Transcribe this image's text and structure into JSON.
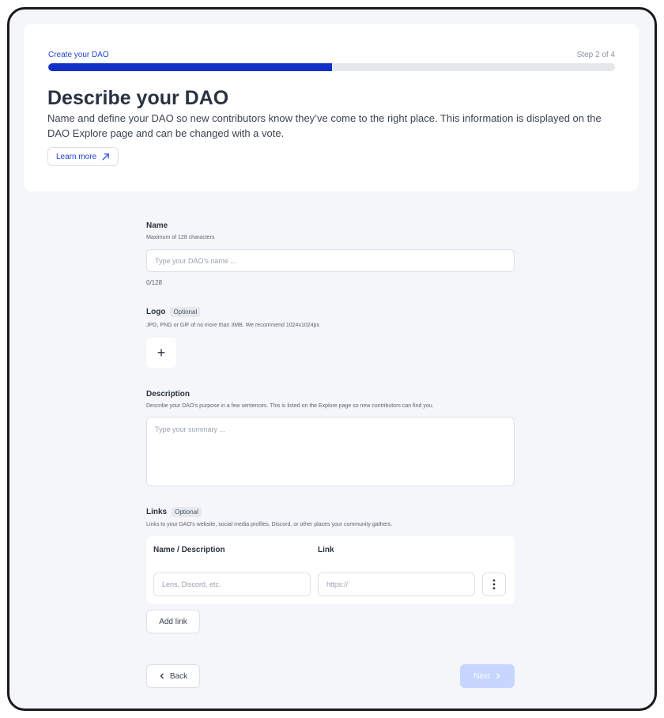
{
  "wizard": {
    "step_title": "Create your DAO",
    "step_count": "Step 2 of 4",
    "progress_fraction": 0.5
  },
  "header": {
    "title": "Describe your DAO",
    "description": "Name and define your DAO so new contributors know they’ve come to the right place. This information is displayed on the DAO Explore page and can be changed with a vote.",
    "learn_more_label": "Learn more"
  },
  "form": {
    "name": {
      "label": "Name",
      "help": "Maximum of 128 characters",
      "placeholder": "Type your DAO’s name ...",
      "value": "",
      "counter": "0/128"
    },
    "logo": {
      "label": "Logo",
      "optional_tag": "Optional",
      "help": "JPG, PNG or GIF of no more than 3MB. We recommend 1024x1024px.",
      "add_symbol": "+"
    },
    "description": {
      "label": "Description",
      "help": "Describe your DAO’s purpose in a few sentences. This is listed on the Explore page so new contributors can find you.",
      "placeholder": "Type your summary ..."
    },
    "links": {
      "label": "Links",
      "optional_tag": "Optional",
      "help": "Links to your DAO’s website, social media profiles, Discord, or other places your community gathers.",
      "col_name": "Name / Description",
      "col_link": "Link",
      "rows": [
        {
          "name_placeholder": "Lens, Discord, etc.",
          "link_placeholder": "https://"
        }
      ],
      "add_link_label": "Add link"
    }
  },
  "footer": {
    "back_label": "Back",
    "next_label": "Next"
  },
  "icons": {
    "learn_more": "arrow-up-right-icon",
    "row_menu": "kebab-menu-icon",
    "back": "chevron-left-icon",
    "next": "chevron-right-icon"
  },
  "colors": {
    "accent": "#1230c8",
    "next_disabled": "#c7d6ff"
  }
}
